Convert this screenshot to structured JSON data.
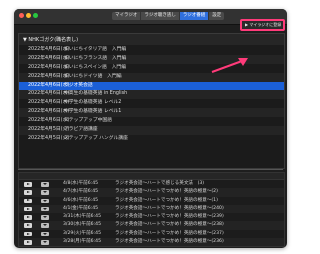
{
  "window": {
    "tabs": [
      {
        "label": "マイラジオ",
        "active": false
      },
      {
        "label": "ラジオ聴き逃し",
        "active": false
      },
      {
        "label": "ラジオ番組",
        "active": true
      },
      {
        "label": "設定",
        "active": false
      }
    ]
  },
  "program_panel": {
    "title": "▼ NHKゴガク(職名表し)",
    "list_button": "▶ マイラジオに登録"
  },
  "program_rows": [
    {
      "date": "2022年4月6日(水)",
      "name": "まいにちイタリア語　入門編",
      "selected": false
    },
    {
      "date": "2022年4月6日(水)",
      "name": "まいにちフランス語　入門編",
      "selected": false
    },
    {
      "date": "2022年4月6日(水)",
      "name": "まいにちスペイン語　入門編",
      "selected": false
    },
    {
      "date": "2022年4月6日(水)",
      "name": "まいにちドイツ語　入門編",
      "selected": false
    },
    {
      "date": "2022年4月6日(水)",
      "name": "ラジオ英会話",
      "selected": true
    },
    {
      "date": "2022年4月6日(水)",
      "name": "中高生の基礎英語 in English",
      "selected": false
    },
    {
      "date": "2022年4月6日(水)",
      "name": "中学生の基礎英語 レベル2",
      "selected": false
    },
    {
      "date": "2022年4月6日(水)",
      "name": "中学生の基礎英語 レベル1",
      "selected": false
    },
    {
      "date": "2022年4月6日(水)",
      "name": "ステップアップ中国語",
      "selected": false
    },
    {
      "date": "2022年4月5日(火)",
      "name": "アラビア語講座",
      "selected": false
    },
    {
      "date": "2022年4月5日(火)",
      "name": "ステップアップ ハングル講座",
      "selected": false
    }
  ],
  "episode_rows": [
    {
      "date": "4/8(水)午前6:45",
      "title": "ラジオ英会話～ハートで感じる英文法　(3)"
    },
    {
      "date": "4/7(水)午前6:45",
      "title": "ラジオ英会話～ハートでつかめ！英語の極意～(2)"
    },
    {
      "date": "4/6(水)午前6:45",
      "title": "ラジオ英会話～ハートでつかめ！英語の極意～(1)"
    },
    {
      "date": "4/1(金)午前6:45",
      "title": "ラジオ英会話～ハートでつかめ！英語の極意～(240)"
    },
    {
      "date": "3/31(木)午前6:45",
      "title": "ラジオ英会話～ハートでつかめ！英語の極意～(239)"
    },
    {
      "date": "3/30(水)午前6:45",
      "title": "ラジオ英会話～ハートでつかめ！英語の極意～(238)"
    },
    {
      "date": "3/29(火)午前6:45",
      "title": "ラジオ英会話～ハートでつかめ！英語の極意～(237)"
    },
    {
      "date": "3/28(月)午前6:45",
      "title": "ラジオ英会話～ハートでつかめ！英語の極意～(236)"
    }
  ],
  "colors": {
    "accent": "#2f6fde",
    "highlight_box": "#ff3b7a",
    "selected_row": "#1b5fd6"
  },
  "icons": {
    "play": "play-icon",
    "download": "download-icon",
    "annotation_arrow": "arrow-icon"
  }
}
